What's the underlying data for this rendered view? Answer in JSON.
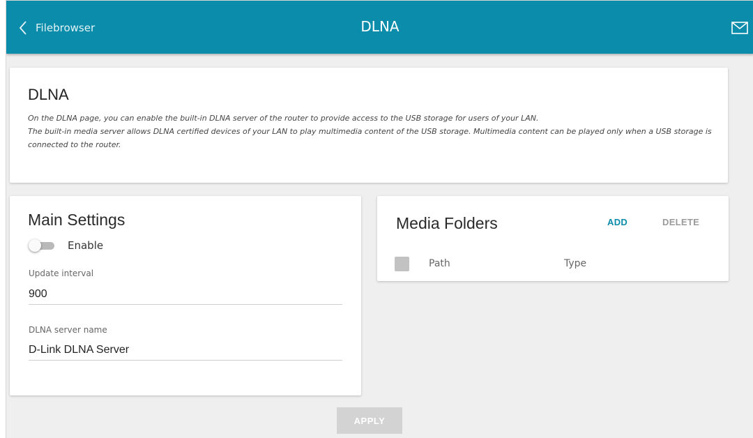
{
  "header": {
    "back_label": "Filebrowser",
    "title": "DLNA",
    "accent_color": "#0b8cab",
    "back_icon": "chevron-left-icon",
    "mail_icon": "mail-icon"
  },
  "intro": {
    "title": "DLNA",
    "line1": "On the DLNA page, you can enable the built-in DLNA server of the router to provide access to the USB storage for users of your LAN.",
    "line2": "The built-in media server allows DLNA certified devices of your LAN to play multimedia content of the USB storage. Multimedia content can be played only when a USB storage is connected to the router."
  },
  "main_settings": {
    "title": "Main Settings",
    "enable_label": "Enable",
    "enable_state": false,
    "update_interval_label": "Update interval",
    "update_interval_value": "900",
    "server_name_label": "DLNA server name",
    "server_name_value": "D-Link DLNA Server"
  },
  "media_folders": {
    "title": "Media Folders",
    "add_label": "ADD",
    "delete_label": "DELETE",
    "columns": [
      "Path",
      "Type"
    ],
    "rows": []
  },
  "footer": {
    "apply_label": "APPLY"
  }
}
